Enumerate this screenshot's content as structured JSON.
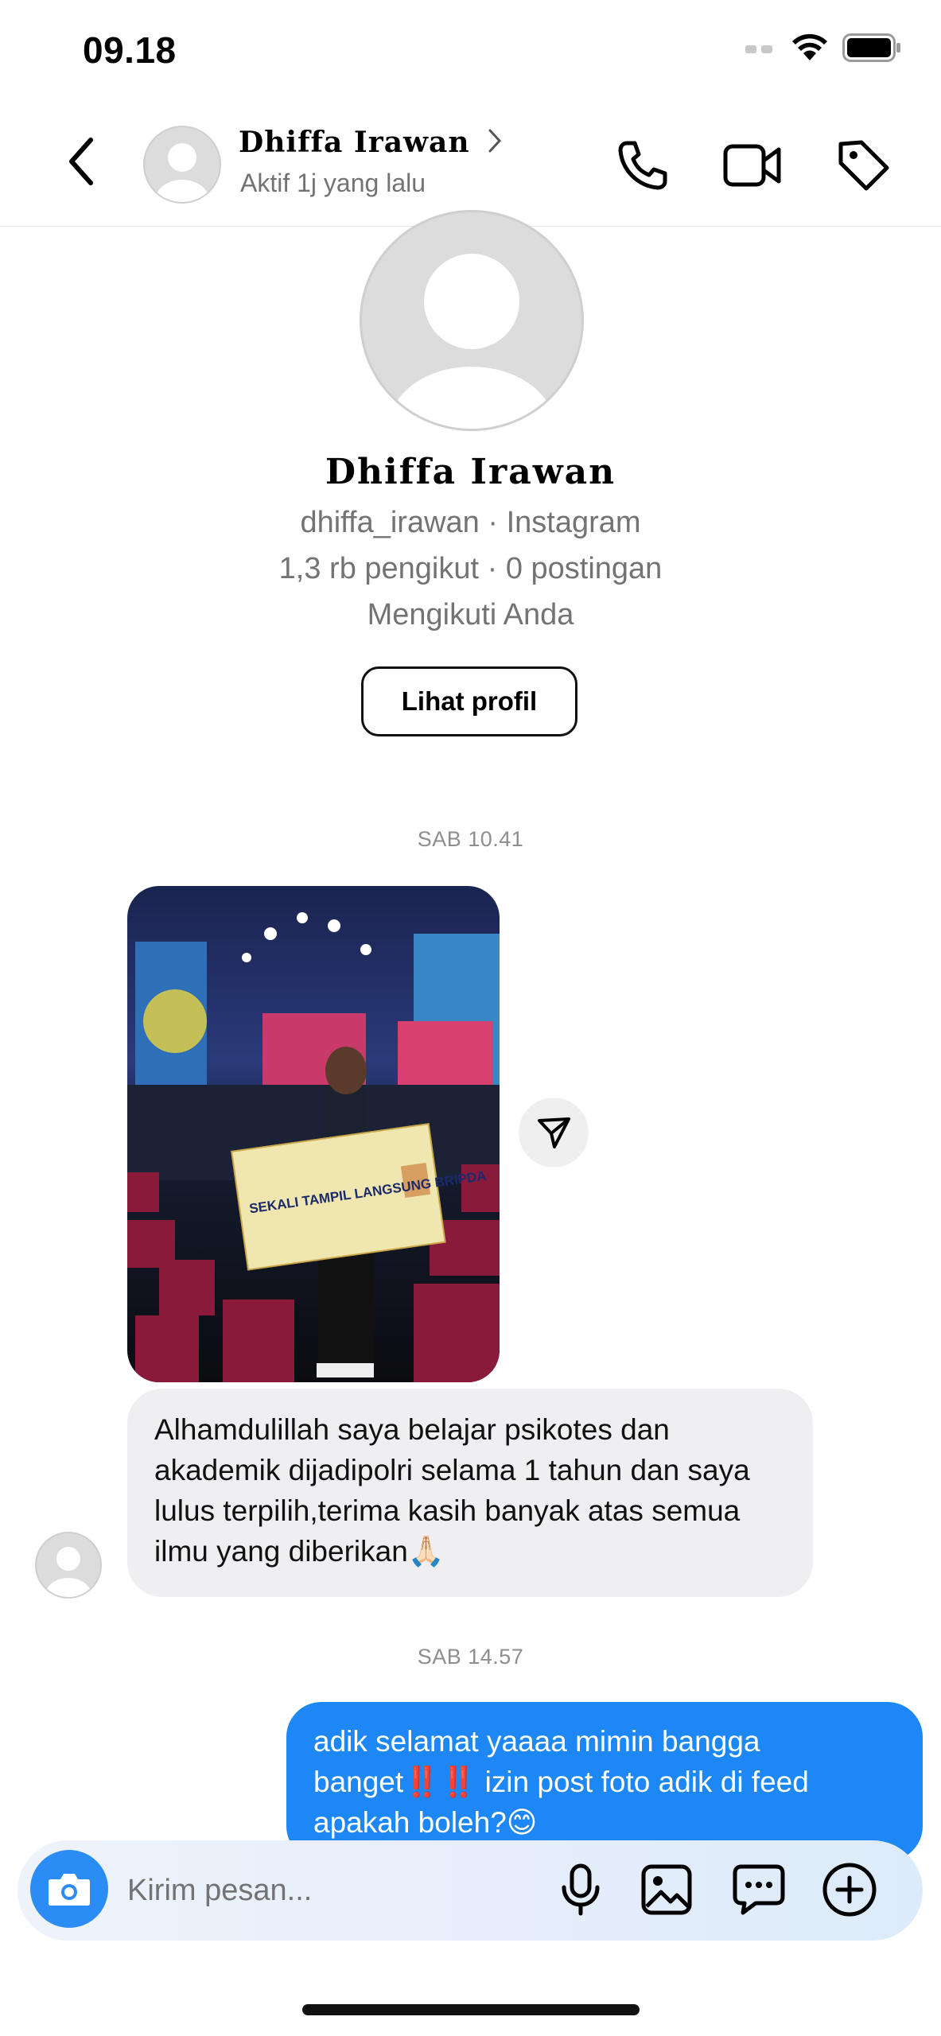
{
  "status_bar": {
    "time": "09.18"
  },
  "header": {
    "name": "Dhiffa Irawan",
    "status": "Aktif 1j yang lalu"
  },
  "profile": {
    "name": "Dhiffa Irawan",
    "username_line": "dhiffa_irawan · Instagram",
    "stats_line": "1,3 rb pengikut · 0 postingan",
    "follow_line": "Mengikuti Anda",
    "view_profile_label": "Lihat profil"
  },
  "messages": [
    {
      "timestamp": "SAB 10.41",
      "photo_sign_text": "SEKALI TAMPIL LANGSUNG BRIPDA",
      "text": "Alhamdulillah saya belajar psikotes dan akademik dijadipolri selama 1 tahun dan saya lulus terpilih,terima kasih banyak atas semua ilmu yang diberikan🙏🏻"
    },
    {
      "timestamp": "SAB 14.57",
      "text": "adik selamat yaaaa mimin bangga banget‼️‼️ izin post foto adik di feed apakah boleh?😊"
    }
  ],
  "composer": {
    "placeholder": "Kirim pesan..."
  },
  "icons": [
    "back-icon",
    "chevron-right-icon",
    "phone-icon",
    "video-camera-icon",
    "tag-icon",
    "send-icon",
    "camera-icon",
    "microphone-icon",
    "gallery-icon",
    "sticker-icon",
    "add-icon",
    "wifi-icon",
    "battery-icon",
    "signal-icon"
  ],
  "colors": {
    "outgoing_bubble": "#1d88f5",
    "incoming_bubble": "#efeff1",
    "camera_button": "#2b8cf5"
  }
}
